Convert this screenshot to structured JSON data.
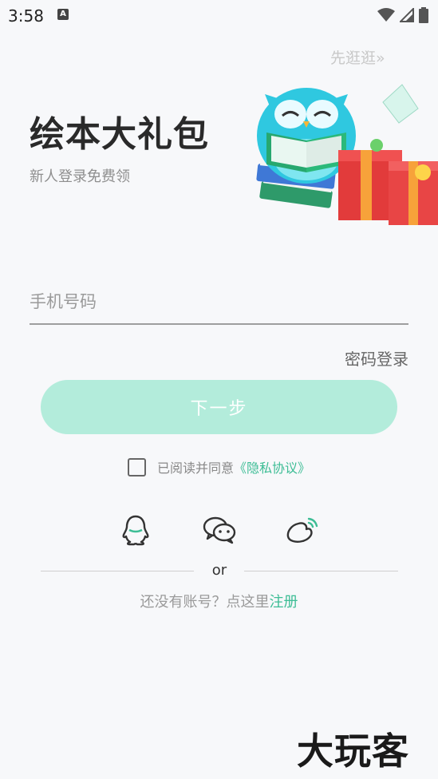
{
  "status_bar": {
    "time": "3:58",
    "notification_badge": "A"
  },
  "header": {
    "skip_label": "先逛逛",
    "skip_icon": "double-chevron-right-icon"
  },
  "hero": {
    "title": "绘本大礼包",
    "subtitle": "新人登录免费领",
    "illustration": "owl-reading-book-with-gift-boxes"
  },
  "login": {
    "phone_placeholder": "手机号码",
    "phone_value": "",
    "password_login_label": "密码登录",
    "next_button_label": "下一步",
    "next_button_color": "#b3ecdb"
  },
  "agreement": {
    "checked": false,
    "text": "已阅读并同意",
    "link_label": "《隐私协议》",
    "link_color": "#3dbd95"
  },
  "social_logins": [
    {
      "name": "qq",
      "icon": "qq-penguin-icon"
    },
    {
      "name": "wechat",
      "icon": "wechat-icon"
    },
    {
      "name": "weibo",
      "icon": "weibo-icon"
    }
  ],
  "divider": {
    "label": "or"
  },
  "register": {
    "prompt": "还没有账号？点这里",
    "link_label": "注册"
  },
  "watermark": {
    "text": "大玩客"
  }
}
